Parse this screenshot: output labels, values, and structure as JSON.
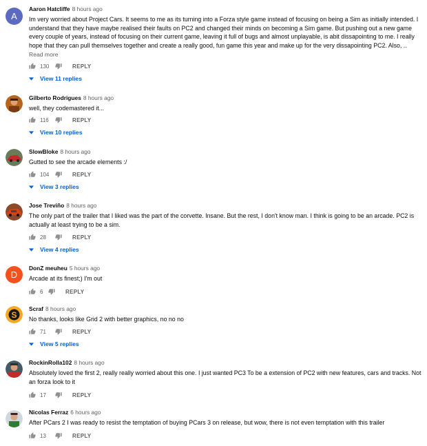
{
  "comments": [
    {
      "author": "Aaron Hatcliffe",
      "time": "8 hours ago",
      "avatar_letter": "A",
      "avatar_color": "#5c6bc0",
      "text": "Im very worried about Project Cars. It seems to me as its turning into a Forza style game instead of focusing on being a Sim as initially intended. I understand that they have maybe realised their faults on PC2 and changed their minds on becoming a Sim game. But pushing out a new game every couple of years, instead of focusing on their current game, leaving it full of bugs and almost unplayable, is abit dissapointing to me. I really hope that they can pull themselves together and create a really good, fun game this year and make up for the very dissapointing PC2. Also, ..",
      "read_more": "Read more",
      "likes": "130",
      "reply_label": "REPLY",
      "view_replies": "View 11 replies"
    },
    {
      "author": "Gilberto Rodrigues",
      "time": "8 hours ago",
      "avatar_icon": "photo-avatar-icon",
      "text": "well, they codemastered it...",
      "likes": "116",
      "reply_label": "REPLY",
      "view_replies": "View 10 replies"
    },
    {
      "author": "SlowBloke",
      "time": "8 hours ago",
      "avatar_icon": "red-car-avatar-icon",
      "text": "Gutted to see the arcade elements :/",
      "likes": "104",
      "reply_label": "REPLY",
      "view_replies": "View 3 replies"
    },
    {
      "author": "Jose Treviño",
      "time": "8 hours ago",
      "avatar_icon": "car-photo-avatar-icon",
      "text": "The only part of the trailer that I liked was the part of the corvette. Insane. But the rest, I don't know man. I think is going to be an arcade. PC2 is actually at least trying to be a sim.",
      "likes": "28",
      "reply_label": "REPLY",
      "view_replies": "View 4 replies"
    },
    {
      "author": "DonZ meuheu",
      "time": "5 hours ago",
      "avatar_letter": "D",
      "avatar_color": "#f4511e",
      "text": "Arcade at its finest;) I'm out",
      "likes": "6",
      "reply_label": "REPLY"
    },
    {
      "author": "Scraf",
      "time": "8 hours ago",
      "avatar_icon": "s-logo-avatar-icon",
      "text": "No thanks, looks like Grid 2 with better graphics, no no no",
      "likes": "71",
      "reply_label": "REPLY",
      "view_replies": "View 5 replies"
    },
    {
      "author": "RockinRolla102",
      "time": "8 hours ago",
      "avatar_icon": "photo-avatar-icon",
      "text": "Absolutely loved the first 2, really really worried about this one. I just wanted PC3 To be a extension of PC2 with new features, cars and tracks. Not an forza look to it",
      "likes": "17",
      "reply_label": "REPLY"
    },
    {
      "author": "Nicolas Ferraz",
      "time": "6 hours ago",
      "avatar_icon": "person-photo-avatar-icon",
      "text": "After PCars 2 I was ready to resist the temptation of buying PCars 3 on release, but wow, there is not even temptation with this trailer",
      "likes": "13",
      "reply_label": "REPLY"
    }
  ]
}
